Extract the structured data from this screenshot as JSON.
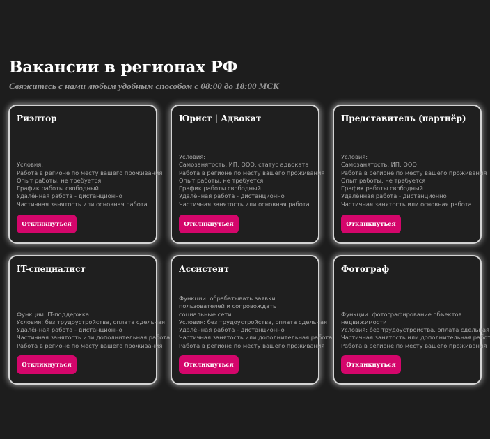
{
  "header": {
    "title": "Вакансии в регионах РФ",
    "subtitle": "Свяжитесь с нами любым удобным способом с 08:00 до 18:00 МСК"
  },
  "cards": [
    {
      "title": "Риэлтор",
      "lines": [
        "Условия:",
        "Работа в регионе по месту вашего проживания",
        "Опыт работы: не требуется",
        "График работы свободный",
        "Удалённая работа - дистанционно",
        "Частичная занятость или основная работа"
      ],
      "button": "Откликнуться"
    },
    {
      "title": "Юрист | Адвокат",
      "lines": [
        "Условия:",
        "Самозанятость, ИП, ООО, статус адвоката",
        "Работа в регионе по месту вашего проживания",
        "Опыт работы: не требуется",
        "График работы свободный",
        "Удалённая работа - дистанционно",
        "Частичная занятость или основная работа"
      ],
      "button": "Откликнуться"
    },
    {
      "title": "Представитель (партнёр)",
      "lines": [
        "Условия:",
        "Самозанятость, ИП, ООО",
        "Работа в регионе по месту вашего проживания",
        "Опыт работы: не требуется",
        "График работы свободный",
        "Удалённая работа - дистанционно",
        "Частичная занятость или основная работа"
      ],
      "button": "Откликнуться"
    },
    {
      "title": "IT-специалист",
      "lines": [
        "Функции: IT-поддержка",
        "Условия: без трудоустройства, оплата сдельная",
        "Удалённая работа - дистанционно",
        "Частичная занятость или дополнительная работа",
        "Работа в регионе по месту вашего проживания"
      ],
      "button": "Откликнуться"
    },
    {
      "title": "Ассистент",
      "lines": [
        "Функции: обрабатывать заявки пользователей и сопровождать социальные сети",
        "Условия: без трудоустройства, оплата сдельная",
        "Удалённая работа - дистанционно",
        "Частичная занятость или дополнительная работа",
        "Работа в регионе по месту вашего проживания"
      ],
      "button": "Откликнуться"
    },
    {
      "title": "Фотограф",
      "lines": [
        "Функции: фотографирование объектов недвижимости",
        "Условия: без трудоустройства, оплата сдельная",
        "Частичная занятость или дополнительная работа",
        "Работа в регионе по месту вашего проживания"
      ],
      "button": "Откликнуться"
    }
  ],
  "colors": {
    "background": "#1d1d1d",
    "card_border": "#d4d4d4",
    "button": "#d4066b",
    "body_text": "#a8a8a8"
  }
}
